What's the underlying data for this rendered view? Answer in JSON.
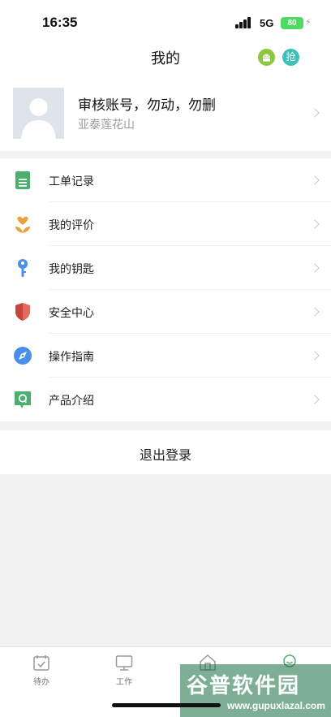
{
  "status_bar": {
    "time": "16:35",
    "network": "5G",
    "battery": "80"
  },
  "header": {
    "title": "我的",
    "icons": [
      {
        "name": "android-icon",
        "color": "#8dc63f"
      },
      {
        "name": "grab-icon",
        "glyph": "抢",
        "color": "#3cc0b7"
      }
    ]
  },
  "profile": {
    "name": "审核账号，勿动，勿删",
    "org": "亚泰莲花山"
  },
  "menu": [
    {
      "label": "工单记录",
      "icon": "document-icon",
      "color": "#4caf6d"
    },
    {
      "label": "我的评价",
      "icon": "heart-flower-icon",
      "color": "#e9a23b"
    },
    {
      "label": "我的钥匙",
      "icon": "key-icon",
      "color": "#4a8fe7"
    },
    {
      "label": "安全中心",
      "icon": "shield-icon",
      "color": "#e26a5f"
    },
    {
      "label": "操作指南",
      "icon": "compass-icon",
      "color": "#4a8fe7"
    },
    {
      "label": "产品介绍",
      "icon": "chat-q-icon",
      "color": "#4caf6d"
    }
  ],
  "logout": {
    "label": "退出登录"
  },
  "tabbar": [
    {
      "label": "待办",
      "icon": "calendar-check-icon"
    },
    {
      "label": "工作",
      "icon": "monitor-icon"
    },
    {
      "label": "",
      "icon": "house-icon"
    },
    {
      "label": "",
      "icon": "smile-user-icon"
    }
  ],
  "watermark": {
    "title": "谷普软件园",
    "url": "www.gupuxlazal.com"
  }
}
